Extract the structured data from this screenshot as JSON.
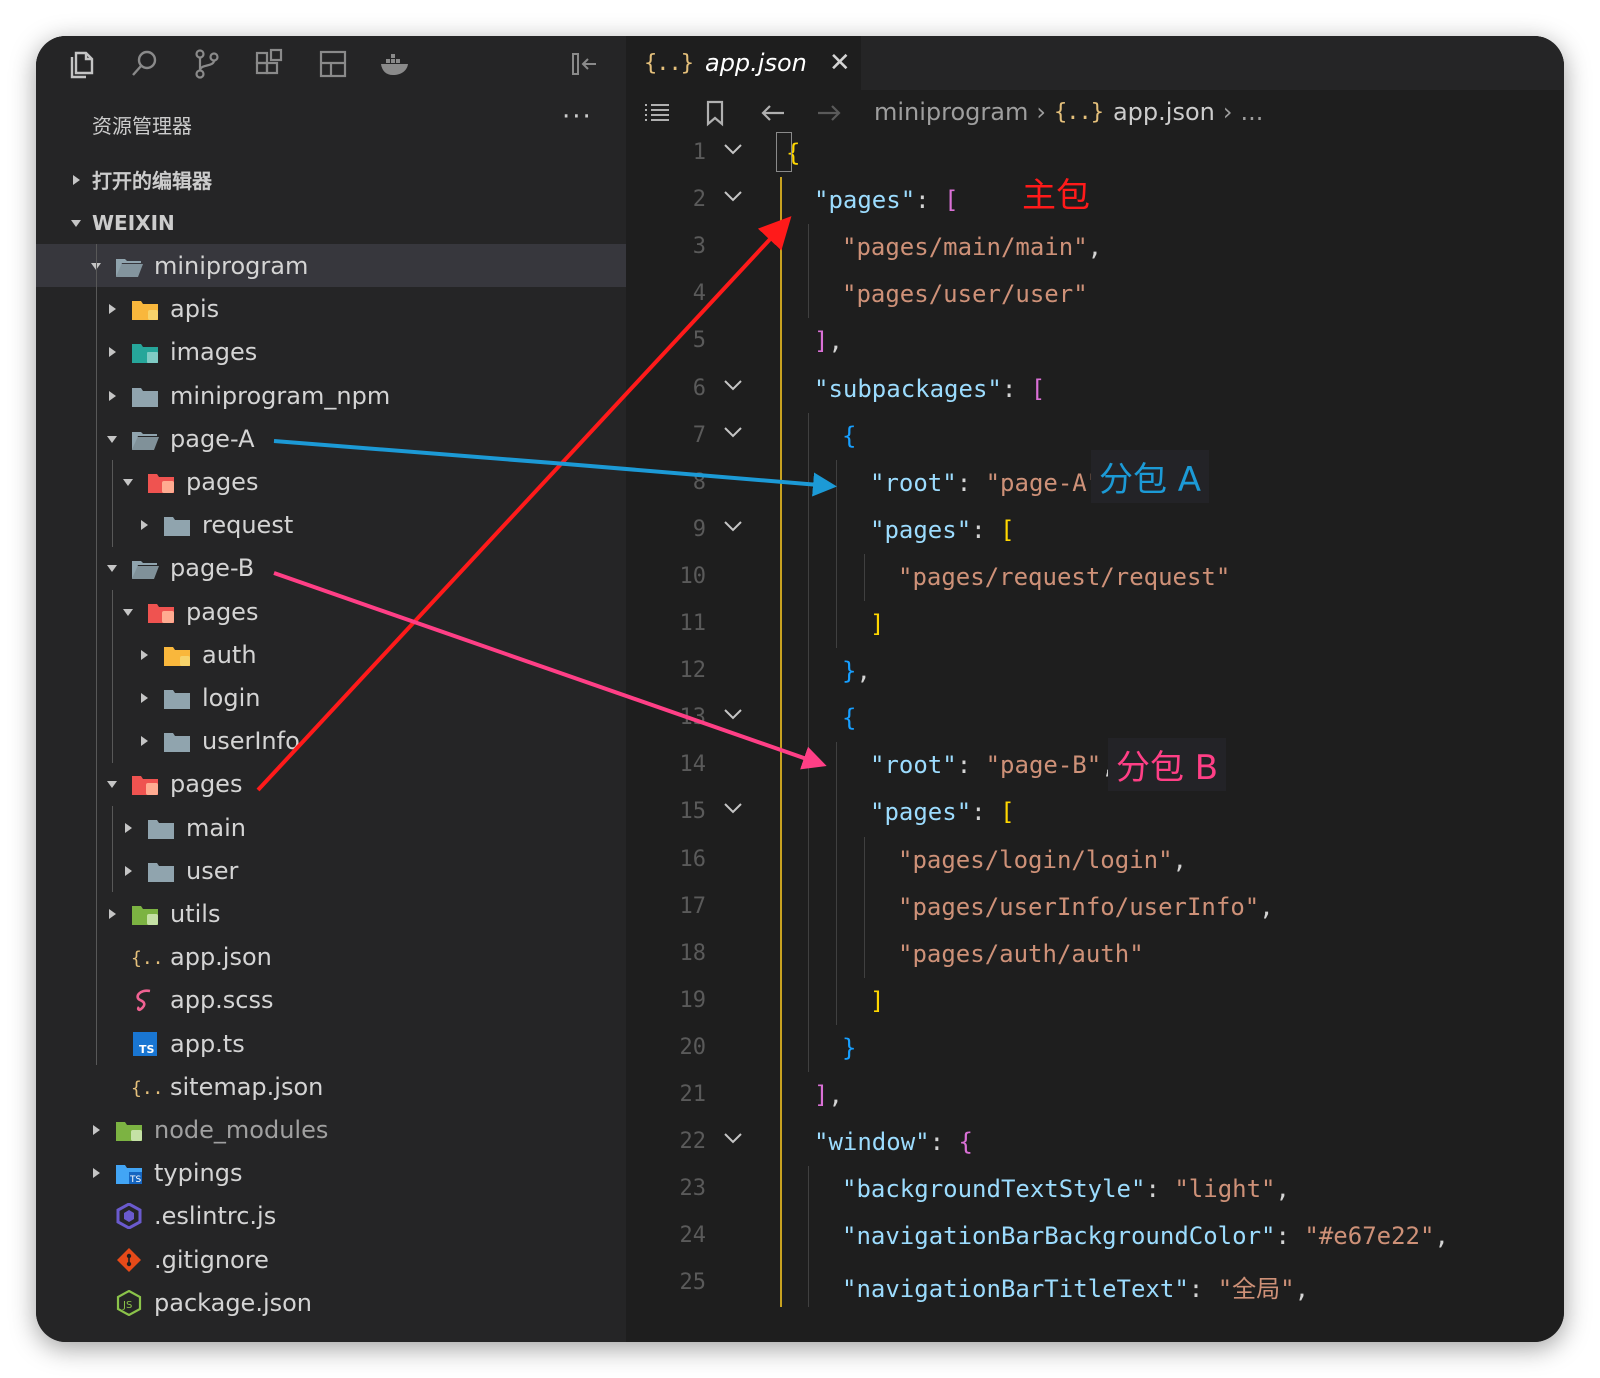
{
  "activity_icons": [
    "files-icon",
    "search-icon",
    "source-control-icon",
    "extensions-icon",
    "layout-icon",
    "docker-icon",
    "collapse-panel-icon"
  ],
  "explorer": {
    "title": "资源管理器",
    "more": "···",
    "sections": [
      {
        "label": "打开的编辑器",
        "expanded": false
      },
      {
        "label": "WEIXIN",
        "expanded": true
      }
    ],
    "tree": [
      {
        "label": "miniprogram",
        "depth": 1,
        "twisty": "open",
        "icon": "folder-open",
        "selected": true
      },
      {
        "label": "apis",
        "depth": 2,
        "twisty": "closed",
        "icon": "folder-yellow"
      },
      {
        "label": "images",
        "depth": 2,
        "twisty": "closed",
        "icon": "folder-teal"
      },
      {
        "label": "miniprogram_npm",
        "depth": 2,
        "twisty": "closed",
        "icon": "folder"
      },
      {
        "label": "page-A",
        "depth": 2,
        "twisty": "open",
        "icon": "folder-open"
      },
      {
        "label": "pages",
        "depth": 3,
        "twisty": "open",
        "icon": "folder-red"
      },
      {
        "label": "request",
        "depth": 4,
        "twisty": "closed",
        "icon": "folder"
      },
      {
        "label": "page-B",
        "depth": 2,
        "twisty": "open",
        "icon": "folder-open"
      },
      {
        "label": "pages",
        "depth": 3,
        "twisty": "open",
        "icon": "folder-red"
      },
      {
        "label": "auth",
        "depth": 4,
        "twisty": "closed",
        "icon": "folder-yellow"
      },
      {
        "label": "login",
        "depth": 4,
        "twisty": "closed",
        "icon": "folder"
      },
      {
        "label": "userInfo",
        "depth": 4,
        "twisty": "closed",
        "icon": "folder"
      },
      {
        "label": "pages",
        "depth": 2,
        "twisty": "open",
        "icon": "folder-red"
      },
      {
        "label": "main",
        "depth": 3,
        "twisty": "closed",
        "icon": "folder"
      },
      {
        "label": "user",
        "depth": 3,
        "twisty": "closed",
        "icon": "folder"
      },
      {
        "label": "utils",
        "depth": 2,
        "twisty": "closed",
        "icon": "folder-green"
      },
      {
        "label": "app.json",
        "depth": 2,
        "twisty": "none",
        "icon": "json"
      },
      {
        "label": "app.scss",
        "depth": 2,
        "twisty": "none",
        "icon": "sass"
      },
      {
        "label": "app.ts",
        "depth": 2,
        "twisty": "none",
        "icon": "ts"
      },
      {
        "label": "sitemap.json",
        "depth": 2,
        "twisty": "none",
        "icon": "json"
      },
      {
        "label": "node_modules",
        "depth": 1,
        "twisty": "closed",
        "icon": "folder-green",
        "dim": true
      },
      {
        "label": "typings",
        "depth": 1,
        "twisty": "closed",
        "icon": "folder-blue"
      },
      {
        "label": ".eslintrc.js",
        "depth": 1,
        "twisty": "none",
        "icon": "eslint"
      },
      {
        "label": ".gitignore",
        "depth": 1,
        "twisty": "none",
        "icon": "git"
      },
      {
        "label": "package.json",
        "depth": 1,
        "twisty": "none",
        "icon": "node"
      }
    ]
  },
  "editor": {
    "tab": {
      "icon": "{..}",
      "label": "app.json",
      "close": "✕"
    },
    "breadcrumb": {
      "folder": "miniprogram",
      "sep": "›",
      "icon": "{..}",
      "file": "app.json",
      "tail": "..."
    },
    "lines": [
      {
        "n": "1",
        "fold": true,
        "indent": 0,
        "parts": [
          [
            "{",
            "b1"
          ]
        ]
      },
      {
        "n": "2",
        "fold": true,
        "indent": 1,
        "parts": [
          [
            "\"pages\"",
            "k"
          ],
          [
            ": ",
            "p"
          ],
          [
            "[",
            "b2"
          ]
        ]
      },
      {
        "n": "3",
        "fold": false,
        "indent": 2,
        "parts": [
          [
            "\"pages/main/main\"",
            "s"
          ],
          [
            ",",
            "p"
          ]
        ]
      },
      {
        "n": "4",
        "fold": false,
        "indent": 2,
        "parts": [
          [
            "\"pages/user/user\"",
            "s"
          ]
        ]
      },
      {
        "n": "5",
        "fold": false,
        "indent": 1,
        "parts": [
          [
            "]",
            "b2"
          ],
          [
            ",",
            "p"
          ]
        ]
      },
      {
        "n": "6",
        "fold": true,
        "indent": 1,
        "parts": [
          [
            "\"subpackages\"",
            "k"
          ],
          [
            ": ",
            "p"
          ],
          [
            "[",
            "b2"
          ]
        ]
      },
      {
        "n": "7",
        "fold": true,
        "indent": 2,
        "parts": [
          [
            "{",
            "b3"
          ]
        ]
      },
      {
        "n": "8",
        "fold": false,
        "indent": 3,
        "parts": [
          [
            "\"root\"",
            "k"
          ],
          [
            ": ",
            "p"
          ],
          [
            "\"page-A\"",
            "s"
          ],
          [
            ",",
            "p"
          ]
        ]
      },
      {
        "n": "9",
        "fold": true,
        "indent": 3,
        "parts": [
          [
            "\"pages\"",
            "k"
          ],
          [
            ": ",
            "p"
          ],
          [
            "[",
            "b1"
          ]
        ]
      },
      {
        "n": "10",
        "fold": false,
        "indent": 4,
        "parts": [
          [
            "\"pages/request/request\"",
            "s"
          ]
        ]
      },
      {
        "n": "11",
        "fold": false,
        "indent": 3,
        "parts": [
          [
            "]",
            "b1"
          ]
        ]
      },
      {
        "n": "12",
        "fold": false,
        "indent": 2,
        "parts": [
          [
            "}",
            "b3"
          ],
          [
            ",",
            "p"
          ]
        ]
      },
      {
        "n": "13",
        "fold": true,
        "indent": 2,
        "parts": [
          [
            "{",
            "b3"
          ]
        ]
      },
      {
        "n": "14",
        "fold": false,
        "indent": 3,
        "parts": [
          [
            "\"root\"",
            "k"
          ],
          [
            ": ",
            "p"
          ],
          [
            "\"page-B\"",
            "s"
          ],
          [
            ",",
            "p"
          ]
        ]
      },
      {
        "n": "15",
        "fold": true,
        "indent": 3,
        "parts": [
          [
            "\"pages\"",
            "k"
          ],
          [
            ": ",
            "p"
          ],
          [
            "[",
            "b1"
          ]
        ]
      },
      {
        "n": "16",
        "fold": false,
        "indent": 4,
        "parts": [
          [
            "\"pages/login/login\"",
            "s"
          ],
          [
            ",",
            "p"
          ]
        ]
      },
      {
        "n": "17",
        "fold": false,
        "indent": 4,
        "parts": [
          [
            "\"pages/userInfo/userInfo\"",
            "s"
          ],
          [
            ",",
            "p"
          ]
        ]
      },
      {
        "n": "18",
        "fold": false,
        "indent": 4,
        "parts": [
          [
            "\"pages/auth/auth\"",
            "s"
          ]
        ]
      },
      {
        "n": "19",
        "fold": false,
        "indent": 3,
        "parts": [
          [
            "]",
            "b1"
          ]
        ]
      },
      {
        "n": "20",
        "fold": false,
        "indent": 2,
        "parts": [
          [
            "}",
            "b3"
          ]
        ]
      },
      {
        "n": "21",
        "fold": false,
        "indent": 1,
        "parts": [
          [
            "]",
            "b2"
          ],
          [
            ",",
            "p"
          ]
        ]
      },
      {
        "n": "22",
        "fold": true,
        "indent": 1,
        "parts": [
          [
            "\"window\"",
            "k"
          ],
          [
            ": ",
            "p"
          ],
          [
            "{",
            "b2"
          ]
        ]
      },
      {
        "n": "23",
        "fold": false,
        "indent": 2,
        "parts": [
          [
            "\"backgroundTextStyle\"",
            "k"
          ],
          [
            ": ",
            "p"
          ],
          [
            "\"light\"",
            "s"
          ],
          [
            ",",
            "p"
          ]
        ]
      },
      {
        "n": "24",
        "fold": false,
        "indent": 2,
        "parts": [
          [
            "\"navigationBarBackgroundColor\"",
            "k"
          ],
          [
            ": ",
            "p"
          ],
          [
            "\"#e67e22\"",
            "s"
          ],
          [
            ",",
            "p"
          ]
        ]
      },
      {
        "n": "25",
        "fold": false,
        "indent": 2,
        "parts": [
          [
            "\"navigationBarTitleText\"",
            "k"
          ],
          [
            ": ",
            "p"
          ],
          [
            "\"全局\"",
            "s"
          ],
          [
            ",",
            "p"
          ]
        ]
      }
    ]
  },
  "annotations": [
    {
      "label": "主包",
      "color": "#ff1a1a"
    },
    {
      "label": "分包 A",
      "color": "#1c9ad6"
    },
    {
      "label": "分包 B",
      "color": "#ff3f86"
    }
  ],
  "colors": {
    "json_key": "#9cdcfe",
    "json_string": "#ce9178",
    "bracket_gold": "#ffd700",
    "bracket_purple": "#da70d6",
    "bracket_blue": "#179fff",
    "json_icon": "#e5c07b"
  }
}
